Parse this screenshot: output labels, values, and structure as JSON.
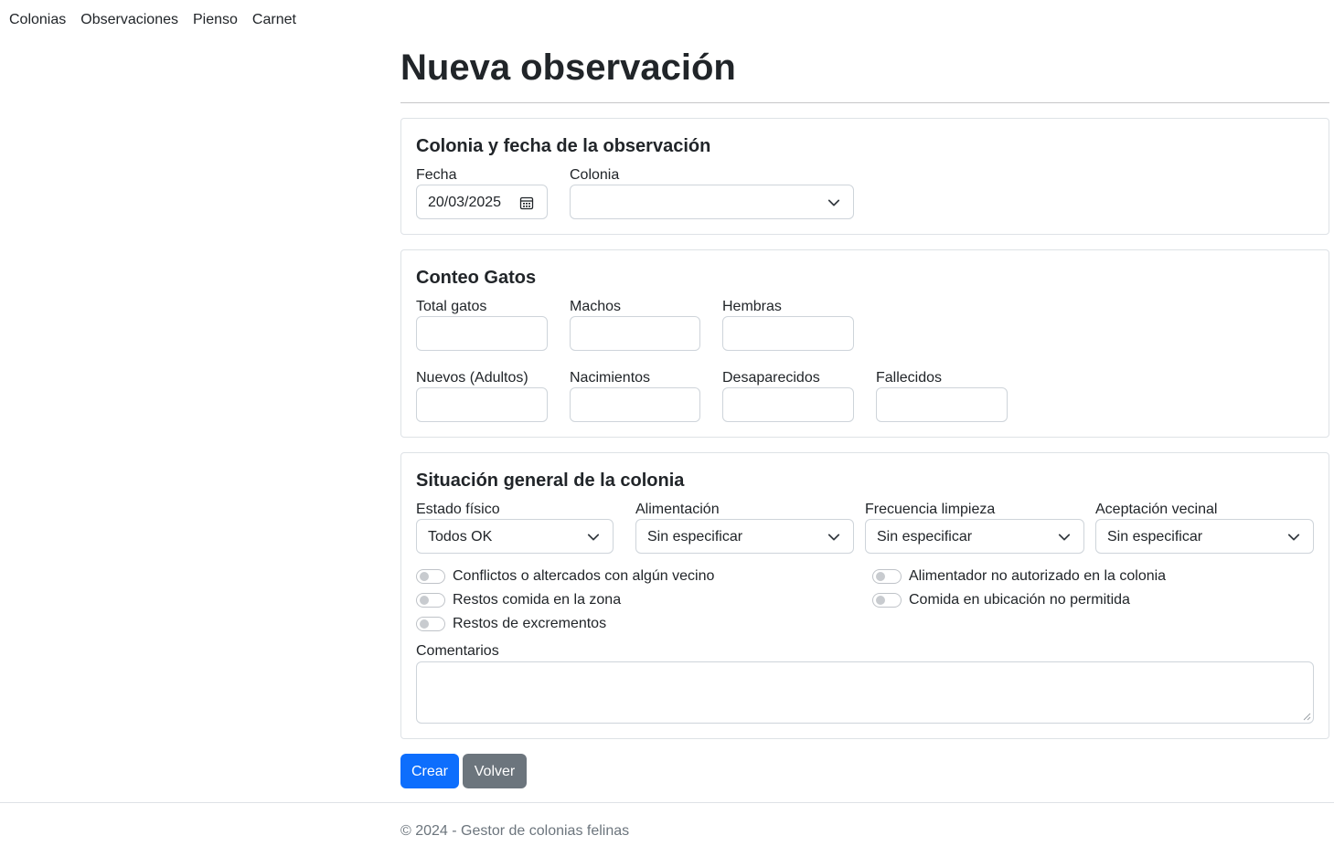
{
  "nav": {
    "items": [
      {
        "label": "Colonias"
      },
      {
        "label": "Observaciones"
      },
      {
        "label": "Pienso"
      },
      {
        "label": "Carnet"
      }
    ]
  },
  "page": {
    "title": "Nueva observación"
  },
  "section_colonia": {
    "title": "Colonia y fecha de la observación",
    "fecha": {
      "label": "Fecha",
      "value": "20/03/2025",
      "icon": "calendar-icon"
    },
    "colonia": {
      "label": "Colonia",
      "value": "",
      "icon": "chevron-down-icon"
    }
  },
  "section_conteo": {
    "title": "Conteo Gatos",
    "fields": {
      "total": {
        "label": "Total gatos",
        "value": ""
      },
      "machos": {
        "label": "Machos",
        "value": ""
      },
      "hembras": {
        "label": "Hembras",
        "value": ""
      },
      "nuevos": {
        "label": "Nuevos (Adultos)",
        "value": ""
      },
      "nacimientos": {
        "label": "Nacimientos",
        "value": ""
      },
      "desaparecidos": {
        "label": "Desaparecidos",
        "value": ""
      },
      "fallecidos": {
        "label": "Fallecidos",
        "value": ""
      }
    }
  },
  "section_situacion": {
    "title": "Situación general de la colonia",
    "selects": {
      "estado": {
        "label": "Estado físico",
        "value": "Todos OK"
      },
      "alimentacion": {
        "label": "Alimentación",
        "value": "Sin especificar"
      },
      "limpieza": {
        "label": "Frecuencia limpieza",
        "value": "Sin especificar"
      },
      "aceptacion": {
        "label": "Aceptación vecinal",
        "value": "Sin especificar"
      }
    },
    "switches": {
      "conflictos": {
        "label": "Conflictos o altercados con algún vecino",
        "checked": false
      },
      "restos_comida": {
        "label": "Restos comida en la zona",
        "checked": false
      },
      "excrementos": {
        "label": "Restos de excrementos",
        "checked": false
      },
      "alimentador": {
        "label": "Alimentador no autorizado en la colonia",
        "checked": false
      },
      "comida_ubicacion": {
        "label": "Comida en ubicación no permitida",
        "checked": false
      }
    },
    "comentarios": {
      "label": "Comentarios",
      "value": ""
    }
  },
  "actions": {
    "create": "Crear",
    "back": "Volver"
  },
  "footer": {
    "text": "© 2024 - Gestor de colonias felinas"
  },
  "colors": {
    "primary": "#0d6efd",
    "secondary": "#6c757d",
    "border": "#dee2e6",
    "input_border": "#ced4da",
    "text": "#212529",
    "muted": "#6c757d"
  }
}
